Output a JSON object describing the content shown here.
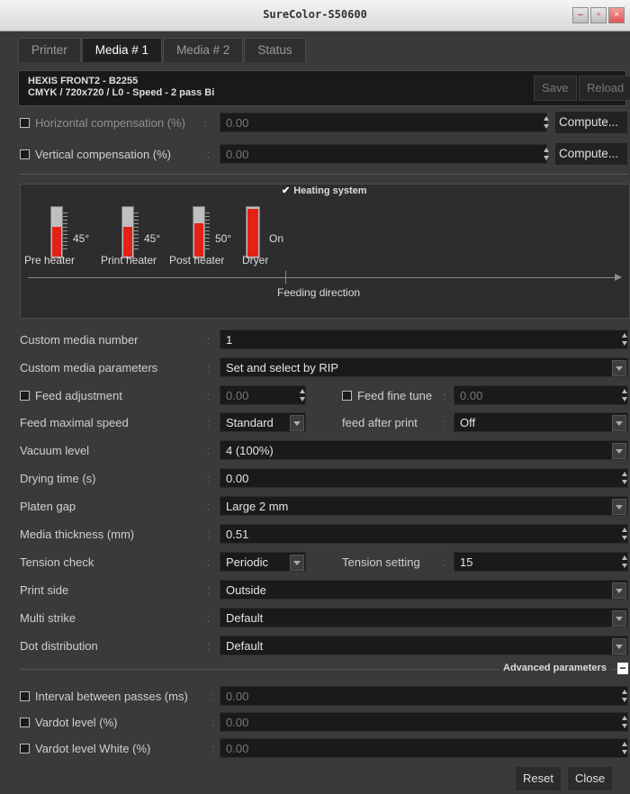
{
  "window": {
    "title": "SureColor-S50600"
  },
  "tabs": [
    {
      "label": "Printer"
    },
    {
      "label": "Media # 1"
    },
    {
      "label": "Media # 2"
    },
    {
      "label": "Status"
    }
  ],
  "media": {
    "name": "HEXIS FRONT2 - B2255",
    "mode": "CMYK / 720x720 / L0 - Speed - 2 pass Bi",
    "save_label": "Save",
    "reload_label": "Reload"
  },
  "compensation": {
    "horizontal_label": "Horizontal compensation (%)",
    "horizontal_value": "0.00",
    "vertical_label": "Vertical compensation (%)",
    "vertical_value": "0.00",
    "compute_label": "Compute..."
  },
  "heating": {
    "legend": "Heating system",
    "checked": true,
    "heaters": [
      {
        "name": "Pre heater",
        "value": "45°",
        "level": 0.62
      },
      {
        "name": "Print heater",
        "value": "45°",
        "level": 0.62
      },
      {
        "name": "Post heater",
        "value": "50°",
        "level": 0.7
      },
      {
        "name": "Dryer",
        "value": "On",
        "level": 0.98
      }
    ],
    "feeding_direction": "Feeding direction"
  },
  "settings": {
    "custom_media_number": {
      "label": "Custom media number",
      "value": "1"
    },
    "custom_media_parameters": {
      "label": "Custom media parameters",
      "value": "Set and select by RIP"
    },
    "feed_adjustment": {
      "label": "Feed adjustment",
      "value": "0.00"
    },
    "feed_fine_tune": {
      "label": "Feed fine tune",
      "value": "0.00"
    },
    "feed_maximal_speed": {
      "label": "Feed maximal speed",
      "value": "Standard"
    },
    "feed_after_print": {
      "label": "feed after print",
      "value": "Off"
    },
    "vacuum_level": {
      "label": "Vacuum level",
      "value": "4 (100%)"
    },
    "drying_time": {
      "label": "Drying time (s)",
      "value": "0.00"
    },
    "platen_gap": {
      "label": "Platen gap",
      "value": "Large 2 mm"
    },
    "media_thickness": {
      "label": "Media thickness (mm)",
      "value": "0.51"
    },
    "tension_check": {
      "label": "Tension check",
      "value": "Periodic"
    },
    "tension_setting": {
      "label": "Tension setting",
      "value": "15"
    },
    "print_side": {
      "label": "Print side",
      "value": "Outside"
    },
    "multi_strike": {
      "label": "Multi strike",
      "value": "Default"
    },
    "dot_distribution": {
      "label": "Dot distribution",
      "value": "Default"
    }
  },
  "advanced": {
    "label": "Advanced parameters",
    "toggle": "−",
    "interval_between_passes": {
      "label": "Interval between passes (ms)",
      "value": "0.00"
    },
    "vardot_level": {
      "label": "Vardot level (%)",
      "value": "0.00"
    },
    "vardot_level_white": {
      "label": "Vardot level White (%)",
      "value": "0.00"
    }
  },
  "footer": {
    "reset_label": "Reset",
    "close_label": "Close"
  },
  "colors": {
    "thermo_fill": "#e32116",
    "panel_bg": "#3a3a3a",
    "field_bg": "#1a1a1a"
  }
}
